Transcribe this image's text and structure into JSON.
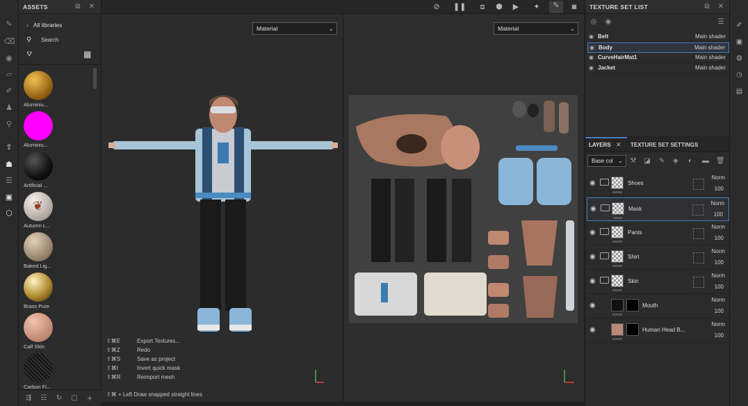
{
  "left_toolbar": [
    "paint-brush-icon",
    "eraser-icon",
    "projection-icon",
    "polygon-fill-icon",
    "smudge-icon",
    "clone-icon",
    "color-picker-icon",
    "export-icon",
    "bake-icon",
    "layer-stack-icon",
    "presets-icon",
    "cube-icon"
  ],
  "assets": {
    "title": "ASSETS",
    "breadcrumb": "All libraries",
    "search_placeholder": "Search",
    "materials": [
      {
        "label": "Aluminiu...",
        "color": "#c48a2c"
      },
      {
        "label": "Aluminiu...",
        "color": "#ff00ff"
      },
      {
        "label": "Artificial ...",
        "color": "#1a1a1a"
      },
      {
        "label": "Autumn L...",
        "color": "#d8d2cc"
      },
      {
        "label": "Baked Lig...",
        "color": "#b8a48c"
      },
      {
        "label": "Brass Pure",
        "color": "#c8a848"
      },
      {
        "label": "Calf Skin",
        "color": "#d8a08a"
      },
      {
        "label": "Carbon Fi...",
        "color": "#2a2a2a"
      }
    ]
  },
  "viewport": {
    "left_mode": "Material",
    "right_mode": "Material",
    "shortcuts": [
      {
        "keys": "⇧⌘E",
        "action": "Export Textures..."
      },
      {
        "keys": "⇧⌘Z",
        "action": "Redo"
      },
      {
        "keys": "⇧⌘S",
        "action": "Save as project"
      },
      {
        "keys": "⇧⌘I",
        "action": "Invert quick mask"
      },
      {
        "keys": "⇧⌘R",
        "action": "Reimport mesh"
      }
    ],
    "hint": "⇧⌘ + Left  Draw snapped straight lines"
  },
  "texture_set_list": {
    "title": "TEXTURE SET LIST",
    "rows": [
      {
        "name": "Belt",
        "shader": "Main shader"
      },
      {
        "name": "Body",
        "shader": "Main shader"
      },
      {
        "name": "CurveHairMat1",
        "shader": "Main shader"
      },
      {
        "name": "Jacket",
        "shader": "Main shader"
      }
    ]
  },
  "layers": {
    "tab_layers": "LAYERS",
    "tab_settings": "TEXTURE SET SETTINGS",
    "channel": "Base col",
    "rows": [
      {
        "name": "Shoes",
        "blend": "Norm",
        "opacity": "100"
      },
      {
        "name": "Mask",
        "blend": "Norm",
        "opacity": "100"
      },
      {
        "name": "Pants",
        "blend": "Norm",
        "opacity": "100"
      },
      {
        "name": "Shirt",
        "blend": "Norm",
        "opacity": "100"
      },
      {
        "name": "Skin",
        "blend": "Norm",
        "opacity": "100"
      },
      {
        "name": "Mouth",
        "blend": "Norm",
        "opacity": "100"
      },
      {
        "name": "Human Head B...",
        "blend": "Norm",
        "opacity": "100"
      }
    ]
  },
  "colors": {
    "accent": "#4a7fbf",
    "selected_row": "#3a3a3a"
  }
}
